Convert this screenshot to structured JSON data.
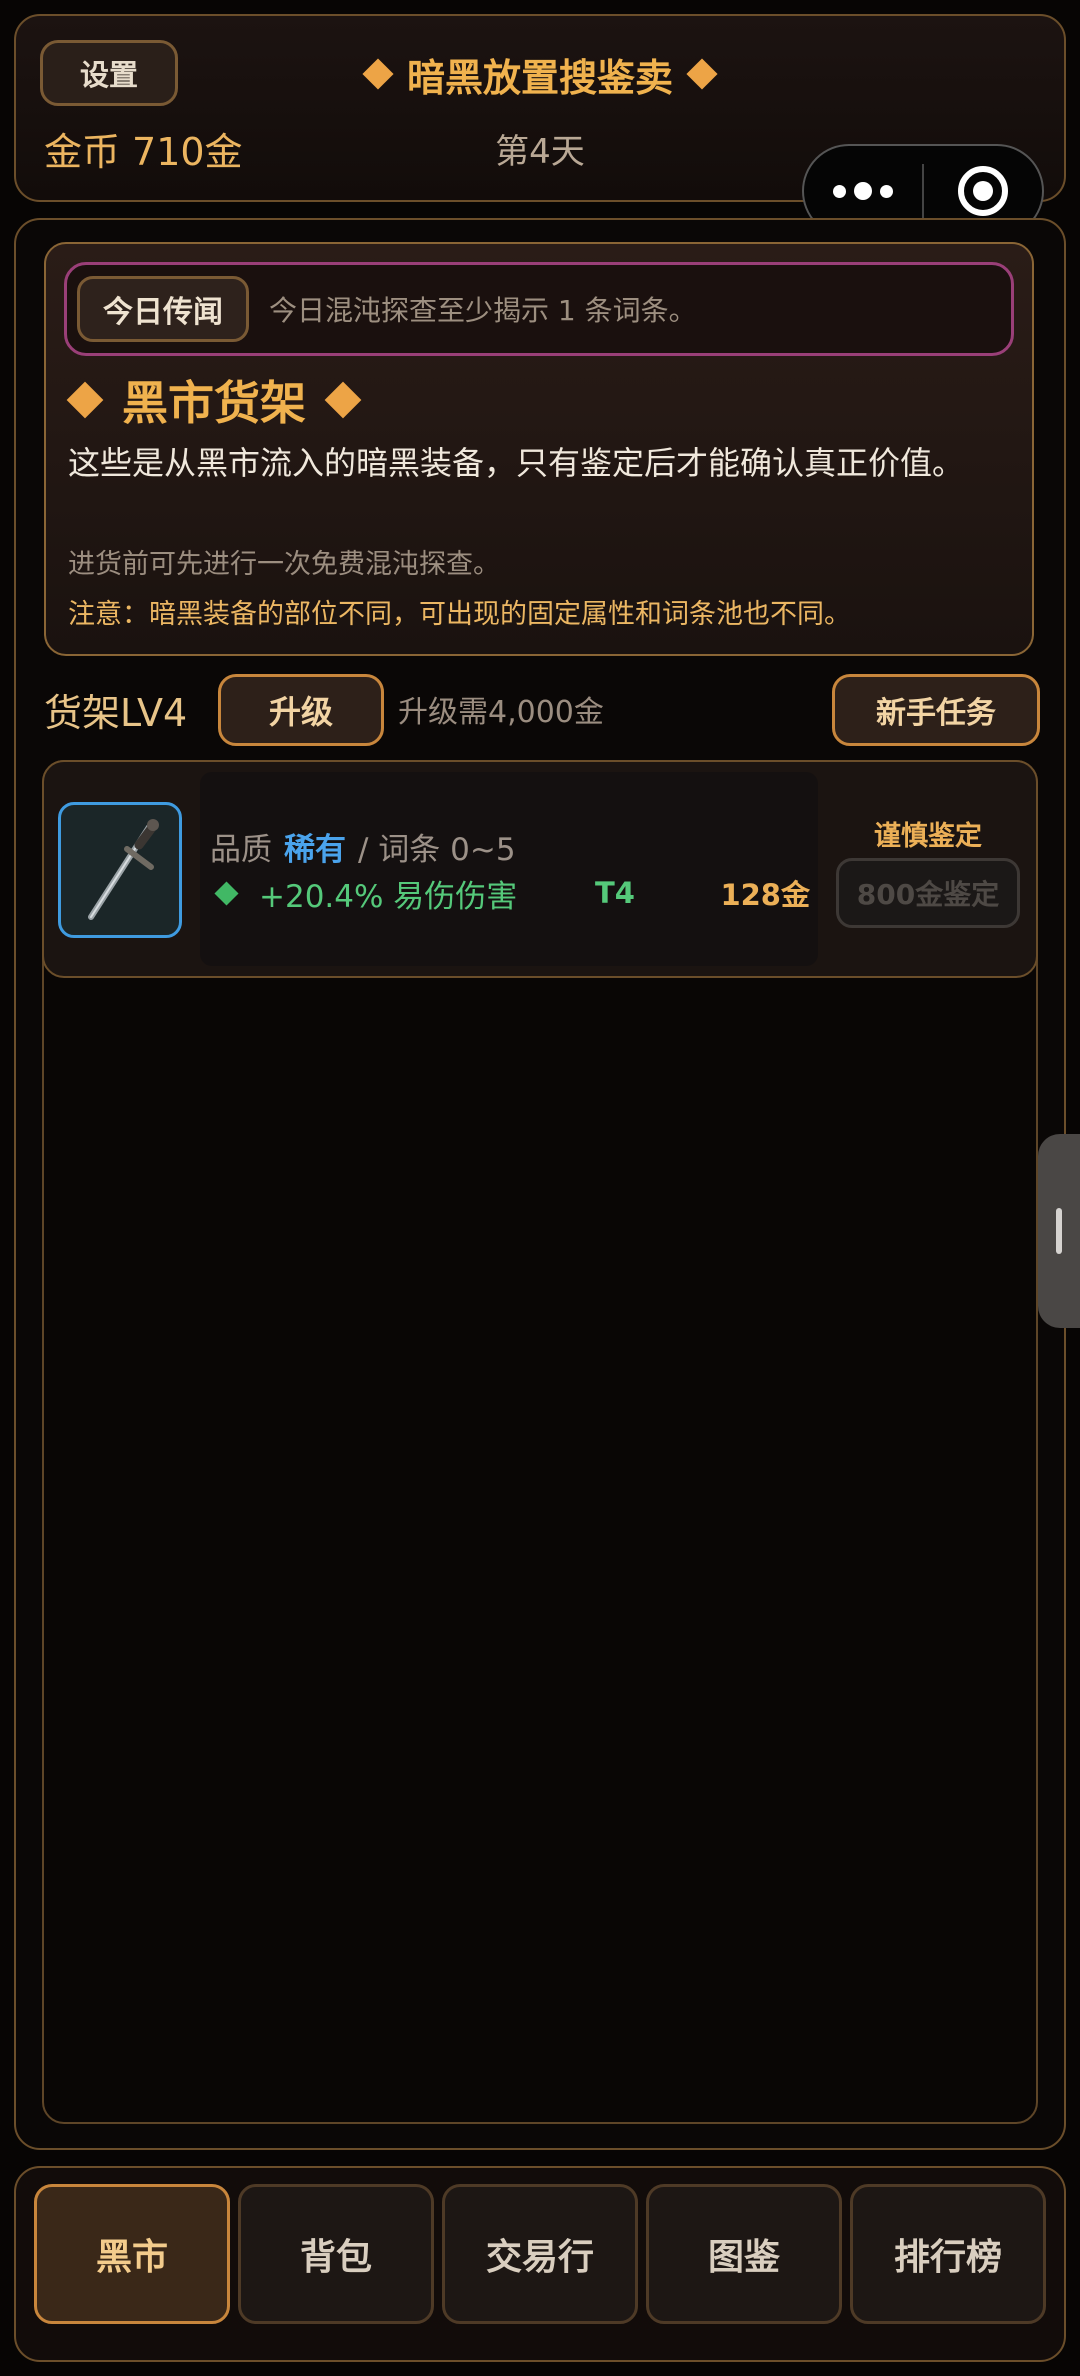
{
  "header": {
    "settings_label": "设置",
    "title": "暗黑放置搜鉴卖",
    "gold_label": "金币",
    "gold_value": "710金",
    "day": "第4天"
  },
  "intro": {
    "news_badge": "今日传闻",
    "news_text": "今日混沌探查至少揭示 1 条词条。",
    "heading": "黑市货架",
    "description": "这些是从黑市流入的暗黑装备，只有鉴定后才能确认真正价值。",
    "hint": "进货前可先进行一次免费混沌探查。",
    "note": "注意：暗黑装备的部位不同，可出现的固定属性和词条池也不同。"
  },
  "shelf": {
    "level_label": "货架LV4",
    "upgrade_label": "升级",
    "upgrade_cost": "升级需4,000金",
    "quest_label": "新手任务"
  },
  "items": [
    {
      "icon": "dagger-icon",
      "quality_label": "品质",
      "quality_value": "稀有",
      "affix_range": "/ 词条 0~5",
      "affix_text": "+20.4% 易伤伤害",
      "tier": "T4",
      "price": "128金",
      "appraise_title": "谨慎鉴定",
      "appraise_button": "800金鉴定"
    }
  ],
  "nav": {
    "tabs": [
      "黑市",
      "背包",
      "交易行",
      "图鉴",
      "排行榜"
    ],
    "active": "黑市"
  },
  "colors": {
    "accent_gold": "#f0b24e",
    "rare_blue": "#4aa3ec",
    "affix_green": "#55c97a",
    "news_border": "#9a3f78"
  }
}
